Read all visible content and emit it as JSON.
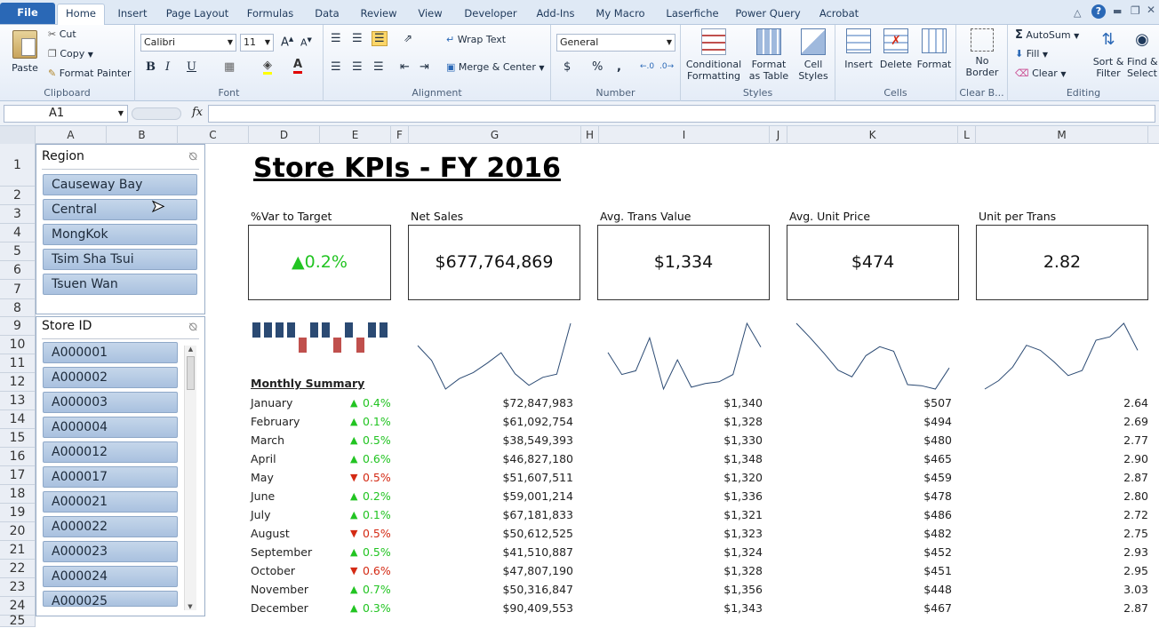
{
  "ribbon_tabs": [
    "File",
    "Home",
    "Insert",
    "Page Layout",
    "Formulas",
    "Data",
    "Review",
    "View",
    "Developer",
    "Add-Ins",
    "My Macro",
    "Laserfiche",
    "Power Query",
    "Acrobat"
  ],
  "ribbon": {
    "clipboard": {
      "paste": "Paste",
      "cut": "Cut",
      "copy": "Copy",
      "format_painter": "Format Painter",
      "label": "Clipboard"
    },
    "font": {
      "name": "Calibri",
      "size": "11",
      "label": "Font",
      "bold": "B",
      "italic": "I",
      "underline": "U"
    },
    "alignment": {
      "wrap": "Wrap Text",
      "merge": "Merge & Center",
      "label": "Alignment"
    },
    "number": {
      "format": "General",
      "label": "Number",
      "currency": "$",
      "percent": "%",
      "comma": ","
    },
    "styles": {
      "conditional": "Conditional",
      "conditional2": "Formatting",
      "format_table": "Format",
      "format_table2": "as Table",
      "cell_styles": "Cell",
      "cell_styles2": "Styles",
      "label": "Styles"
    },
    "cells": {
      "insert": "Insert",
      "delete": "Delete",
      "format": "Format",
      "label": "Cells"
    },
    "clear_borders": {
      "no": "No",
      "border": "Border",
      "label": "Clear B..."
    },
    "editing": {
      "autosum": "AutoSum",
      "fill": "Fill",
      "clear": "Clear",
      "sort": "Sort &",
      "sort2": "Filter",
      "find": "Find &",
      "find2": "Select",
      "label": "Editing"
    }
  },
  "formula_bar": {
    "name_box": "A1",
    "fx": "fx",
    "formula": ""
  },
  "columns": [
    "A",
    "B",
    "C",
    "D",
    "E",
    "F",
    "G",
    "H",
    "I",
    "J",
    "K",
    "L",
    "M"
  ],
  "rows": [
    "1",
    "2",
    "3",
    "4",
    "5",
    "6",
    "7",
    "8",
    "9",
    "10",
    "11",
    "12",
    "13",
    "14",
    "15",
    "16",
    "17",
    "18",
    "19",
    "20",
    "21",
    "22",
    "23",
    "24",
    "25"
  ],
  "slicers": {
    "region": {
      "title": "Region",
      "items": [
        "Causeway Bay",
        "Central",
        "MongKok",
        "Tsim Sha Tsui",
        "Tsuen Wan"
      ]
    },
    "store": {
      "title": "Store ID",
      "items": [
        "A000001",
        "A000002",
        "A000003",
        "A000004",
        "A000012",
        "A000017",
        "A000021",
        "A000022",
        "A000023",
        "A000024",
        "A000025"
      ]
    }
  },
  "dashboard": {
    "title": "Store KPIs - FY 2016",
    "kpis": [
      {
        "label": "%Var to Target",
        "value": "0.2%",
        "trend": "up"
      },
      {
        "label": "Net Sales",
        "value": "$677,764,869"
      },
      {
        "label": "Avg. Trans Value",
        "value": "$1,334"
      },
      {
        "label": "Avg. Unit Price",
        "value": "$474"
      },
      {
        "label": "Unit per Trans",
        "value": "2.82"
      }
    ],
    "monthly_summary_label": "Monthly Summary",
    "months": [
      {
        "month": "January",
        "var": "0.4%",
        "dir": "up",
        "sales": "$72,847,983",
        "atv": "$1,340",
        "aup": "$507",
        "upt": "2.64"
      },
      {
        "month": "February",
        "var": "0.1%",
        "dir": "up",
        "sales": "$61,092,754",
        "atv": "$1,328",
        "aup": "$494",
        "upt": "2.69"
      },
      {
        "month": "March",
        "var": "0.5%",
        "dir": "up",
        "sales": "$38,549,393",
        "atv": "$1,330",
        "aup": "$480",
        "upt": "2.77"
      },
      {
        "month": "April",
        "var": "0.6%",
        "dir": "up",
        "sales": "$46,827,180",
        "atv": "$1,348",
        "aup": "$465",
        "upt": "2.90"
      },
      {
        "month": "May",
        "var": "0.5%",
        "dir": "down",
        "sales": "$51,607,511",
        "atv": "$1,320",
        "aup": "$459",
        "upt": "2.87"
      },
      {
        "month": "June",
        "var": "0.2%",
        "dir": "up",
        "sales": "$59,001,214",
        "atv": "$1,336",
        "aup": "$478",
        "upt": "2.80"
      },
      {
        "month": "July",
        "var": "0.1%",
        "dir": "up",
        "sales": "$67,181,833",
        "atv": "$1,321",
        "aup": "$486",
        "upt": "2.72"
      },
      {
        "month": "August",
        "var": "0.5%",
        "dir": "down",
        "sales": "$50,612,525",
        "atv": "$1,323",
        "aup": "$482",
        "upt": "2.75"
      },
      {
        "month": "September",
        "var": "0.5%",
        "dir": "up",
        "sales": "$41,510,887",
        "atv": "$1,324",
        "aup": "$452",
        "upt": "2.93"
      },
      {
        "month": "October",
        "var": "0.6%",
        "dir": "down",
        "sales": "$47,807,190",
        "atv": "$1,328",
        "aup": "$451",
        "upt": "2.95"
      },
      {
        "month": "November",
        "var": "0.7%",
        "dir": "up",
        "sales": "$50,316,847",
        "atv": "$1,356",
        "aup": "$448",
        "upt": "3.03"
      },
      {
        "month": "December",
        "var": "0.3%",
        "dir": "up",
        "sales": "$90,409,553",
        "atv": "$1,343",
        "aup": "$467",
        "upt": "2.87"
      }
    ]
  },
  "sparklines": {
    "winloss": [
      1,
      1,
      1,
      1,
      -1,
      1,
      1,
      -1,
      1,
      -1,
      1,
      1
    ],
    "sales": [
      72847983,
      61092754,
      38549393,
      46827180,
      51607511,
      59001214,
      67181833,
      50612525,
      41510887,
      47807190,
      50316847,
      90409553
    ],
    "atv": [
      1340,
      1328,
      1330,
      1348,
      1320,
      1336,
      1321,
      1323,
      1324,
      1328,
      1356,
      1343
    ],
    "aup": [
      507,
      494,
      480,
      465,
      459,
      478,
      486,
      482,
      452,
      451,
      448,
      467
    ],
    "upt": [
      2.64,
      2.69,
      2.77,
      2.9,
      2.87,
      2.8,
      2.72,
      2.75,
      2.93,
      2.95,
      3.03,
      2.87
    ]
  },
  "colors": {
    "up": "#22c422",
    "down": "#d42a14",
    "winloss_up": "#2b4a73",
    "winloss_down": "#c0504d",
    "spark": "#2b4a73"
  }
}
